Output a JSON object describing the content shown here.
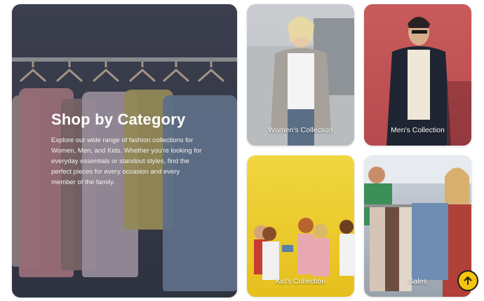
{
  "hero": {
    "title": "Shop by Category",
    "description": "Explore our wide range of fashion collections for Women, Men, and Kids. Whether you're looking for everyday essentials or standout styles, find the perfect pieces for every occasion and every member of the family."
  },
  "categories": [
    {
      "label": "Women's Collection"
    },
    {
      "label": "Men's Collection"
    },
    {
      "label": "Kid's Collection"
    },
    {
      "label": "Sales"
    }
  ],
  "scroll_top": {
    "icon": "arrow-up-icon"
  },
  "colors": {
    "accent_yellow": "#f5c40b",
    "hero_bg": "#434856",
    "text_white": "#ffffff"
  }
}
